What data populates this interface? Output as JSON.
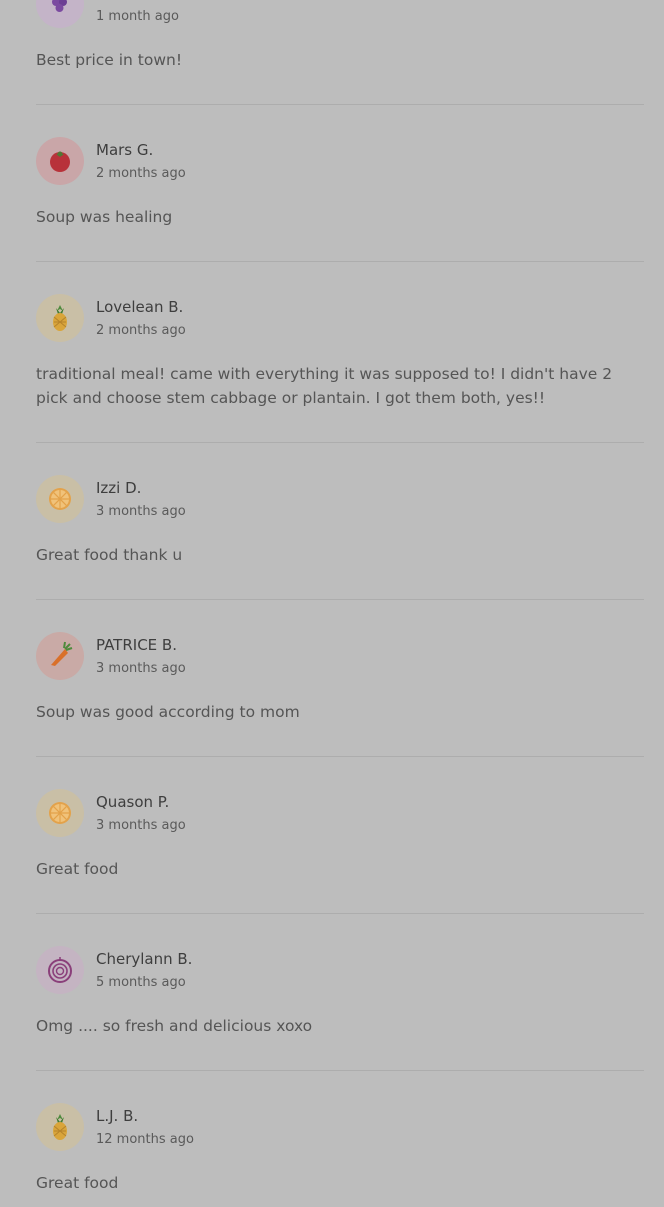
{
  "reviews": [
    {
      "name": "",
      "time": "1 month ago",
      "text": "Best price in town!",
      "avatar_icon": "grapes-icon",
      "avatar_bg": "#c4b4c8"
    },
    {
      "name": "Mars G.",
      "time": "2 months ago",
      "text": "Soup was healing",
      "avatar_icon": "tomato-icon",
      "avatar_bg": "#c9a6a8"
    },
    {
      "name": "Lovelean B.",
      "time": "2 months ago",
      "text": "traditional meal! came with everything it was supposed to! I didn't have 2 pick and choose stem cabbage or plantain. I got them both, yes!!",
      "avatar_icon": "pineapple-icon",
      "avatar_bg": "#c9bfa6"
    },
    {
      "name": "Izzi D.",
      "time": "3 months ago",
      "text": "Great food thank u",
      "avatar_icon": "orange-slice-icon",
      "avatar_bg": "#c9bfa6"
    },
    {
      "name": "PATRICE B.",
      "time": "3 months ago",
      "text": "Soup was good according to mom",
      "avatar_icon": "carrot-icon",
      "avatar_bg": "#c9aaa6"
    },
    {
      "name": "Quason P.",
      "time": "3 months ago",
      "text": "Great food",
      "avatar_icon": "orange-slice-icon",
      "avatar_bg": "#c9bfa6"
    },
    {
      "name": "Cherylann B.",
      "time": "5 months ago",
      "text": "Omg .... so fresh and delicious xoxo",
      "avatar_icon": "onion-icon",
      "avatar_bg": "#c4b4c2"
    },
    {
      "name": "L.J. B.",
      "time": "12 months ago",
      "text": "Great food",
      "avatar_icon": "pineapple-icon",
      "avatar_bg": "#c9bfa6"
    }
  ]
}
